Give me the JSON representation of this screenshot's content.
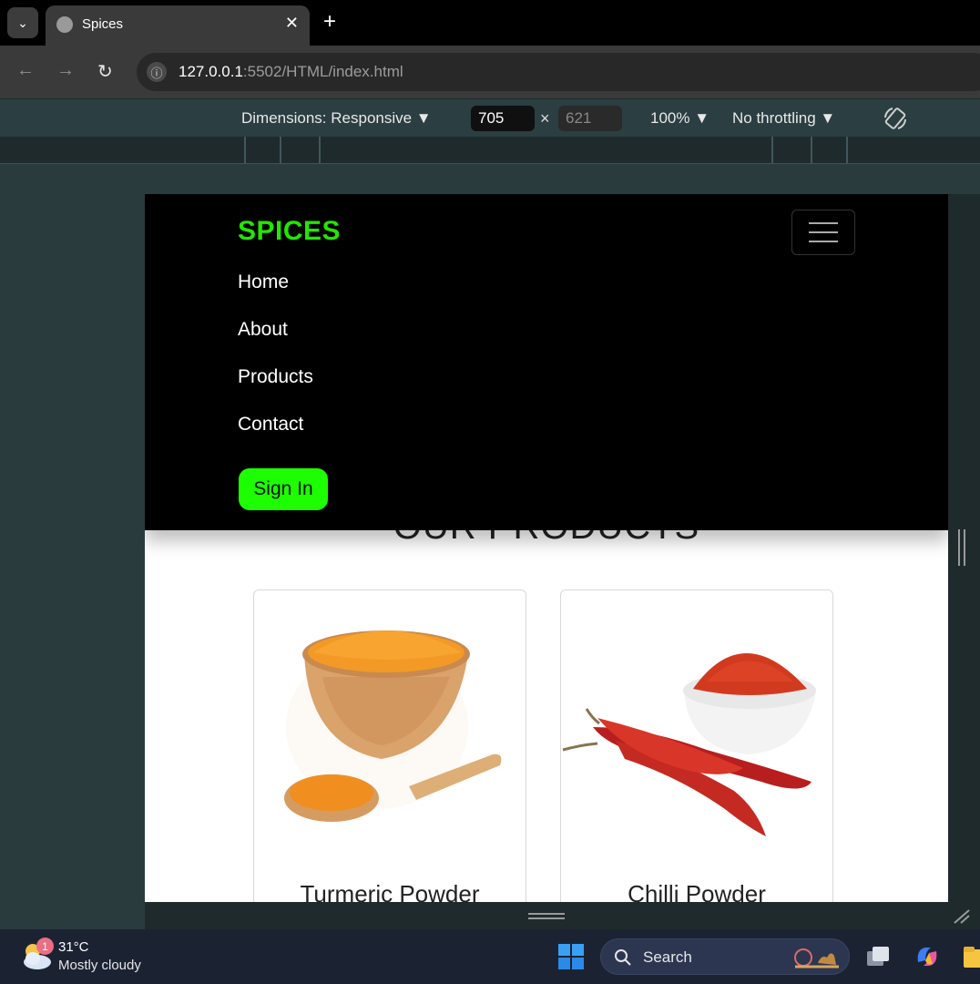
{
  "browser": {
    "tab_title": "Spices",
    "url_host": "127.0.0.1",
    "url_path": ":5502/HTML/index.html"
  },
  "devtools": {
    "dimensions_label": "Dimensions: Responsive ▼",
    "width_value": "705",
    "times": "×",
    "height_value": "621",
    "zoom_label": "100% ▼",
    "throttle_label": "No throttling ▼"
  },
  "site": {
    "brand": "SPICES",
    "nav": [
      "Home",
      "About",
      "Products",
      "Contact"
    ],
    "signin_label": "Sign In",
    "section_title": "OUR PRODUCTS",
    "products": [
      {
        "name": "Turmeric Powder"
      },
      {
        "name": "Chilli Powder"
      }
    ]
  },
  "taskbar": {
    "weather_badge": "1",
    "temperature": "31°C",
    "condition": "Mostly cloudy",
    "search_label": "Search"
  }
}
